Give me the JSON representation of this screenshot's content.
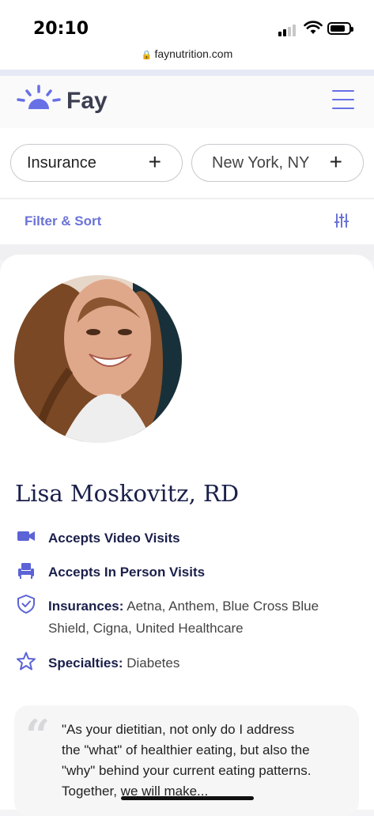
{
  "status": {
    "time": "20:10"
  },
  "browser": {
    "url": "faynutrition.com"
  },
  "header": {
    "brand": "Fay"
  },
  "filters": {
    "insurance_label": "Insurance",
    "location_label": "New York, NY",
    "filter_sort_label": "Filter & Sort"
  },
  "provider": {
    "name": "Lisa Moskovitz, RD",
    "video_visits": "Accepts Video Visits",
    "in_person_visits": "Accepts In Person Visits",
    "insurances_label": "Insurances:",
    "insurances_value": "Aetna, Anthem, Blue Cross Blue Shield, Cigna, United Healthcare",
    "specialties_label": "Specialties:",
    "specialties_value": "Diabetes",
    "quote": "\"As your dietitian, not only do I address the \"what\" of healthier eating, but also the \"why\" behind your current eating patterns. Together, we will make..."
  },
  "colors": {
    "accent": "#6870e6",
    "navy": "#1a1f4a"
  }
}
